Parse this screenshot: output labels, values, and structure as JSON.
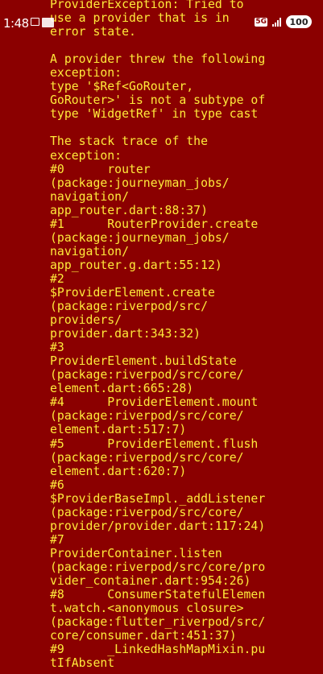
{
  "status_bar": {
    "time": "1:48",
    "network": "5G",
    "battery": "100"
  },
  "error": {
    "lines": [
      "ProviderException: Tried to",
      "use a provider that is in",
      "error state.",
      "",
      "A provider threw the following",
      "exception:",
      "type '$Ref<GoRouter,",
      "GoRouter>' is not a subtype of",
      "type 'WidgetRef' in type cast",
      "",
      "The stack trace of the",
      "exception:",
      "#0      router",
      "(package:journeyman_jobs/",
      "navigation/",
      "app_router.dart:88:37)",
      "#1      RouterProvider.create",
      "(package:journeyman_jobs/",
      "navigation/",
      "app_router.g.dart:55:12)",
      "#2",
      "$ProviderElement.create",
      "(package:riverpod/src/",
      "providers/",
      "provider.dart:343:32)",
      "#3",
      "ProviderElement.buildState",
      "(package:riverpod/src/core/",
      "element.dart:665:28)",
      "#4      ProviderElement.mount",
      "(package:riverpod/src/core/",
      "element.dart:517:7)",
      "#5      ProviderElement.flush",
      "(package:riverpod/src/core/",
      "element.dart:620:7)",
      "#6",
      "$ProviderBaseImpl._addListener",
      "(package:riverpod/src/core/",
      "provider/provider.dart:117:24)",
      "#7",
      "ProviderContainer.listen",
      "(package:riverpod/src/core/pro",
      "vider_container.dart:954:26)",
      "#8      ConsumerStatefulElemen",
      "t.watch.<anonymous closure>",
      "(package:flutter_riverpod/src/",
      "core/consumer.dart:451:37)",
      "#9      _LinkedHashMapMixin.pu",
      "tIfAbsent"
    ]
  }
}
